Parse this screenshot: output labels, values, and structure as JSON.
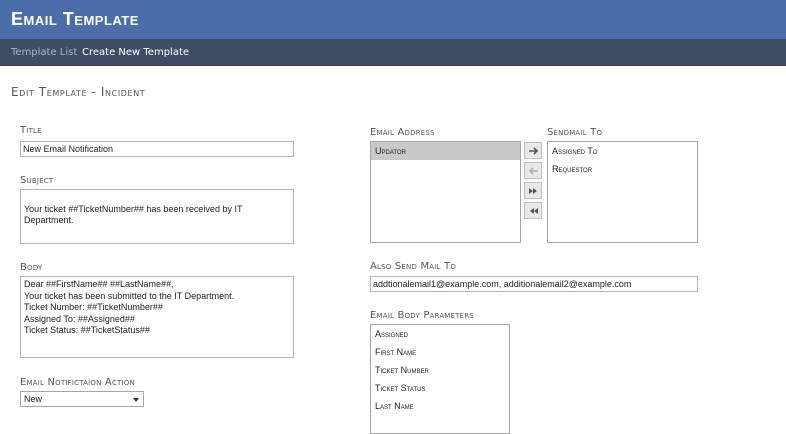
{
  "app": {
    "title": "Email Template"
  },
  "nav": {
    "template_list": "Template List",
    "create_new": "Create New Template"
  },
  "page": {
    "heading": "Edit Template - Incident"
  },
  "form": {
    "title_label": "Title",
    "title_value": "New Email Notification",
    "subject_label": "Subject",
    "subject_value": "Your ticket ##TicketNumber## has been received by IT Department.",
    "body_label": "Body",
    "body_lines": [
      "Dear ##FirstName## ##LastName##,",
      "Your ticket has been submitted to the IT Department.",
      "Ticket Number: ##TicketNumber##",
      "Assigned To: ##Assigned##",
      "Ticket Status: ##TicketStatus##"
    ],
    "action_label": "Email Notifictaion Action",
    "action_value": "New"
  },
  "email_address": {
    "label": "Email Address",
    "items": [
      "Updator"
    ]
  },
  "sendmail_to": {
    "label": "Sendmail To",
    "items": [
      "Assigned To",
      "Requestor"
    ]
  },
  "also_send": {
    "label": "Also Send Mail To",
    "value": "addtionalemail1@example.com, additionalemail2@example.com"
  },
  "params": {
    "label": "Email Body Parameters",
    "items": [
      "Assigned",
      "First Name",
      "Ticket Number",
      "Ticket Status",
      "Last Name"
    ]
  },
  "icons": {
    "move_right": "arrow-right-icon",
    "move_left": "arrow-left-icon",
    "move_all_right": "double-arrow-right-icon",
    "move_all_left": "double-arrow-left-icon"
  },
  "colors": {
    "header": "#4b6da9",
    "nav": "#404c63",
    "selected": "#c9c9c9"
  }
}
